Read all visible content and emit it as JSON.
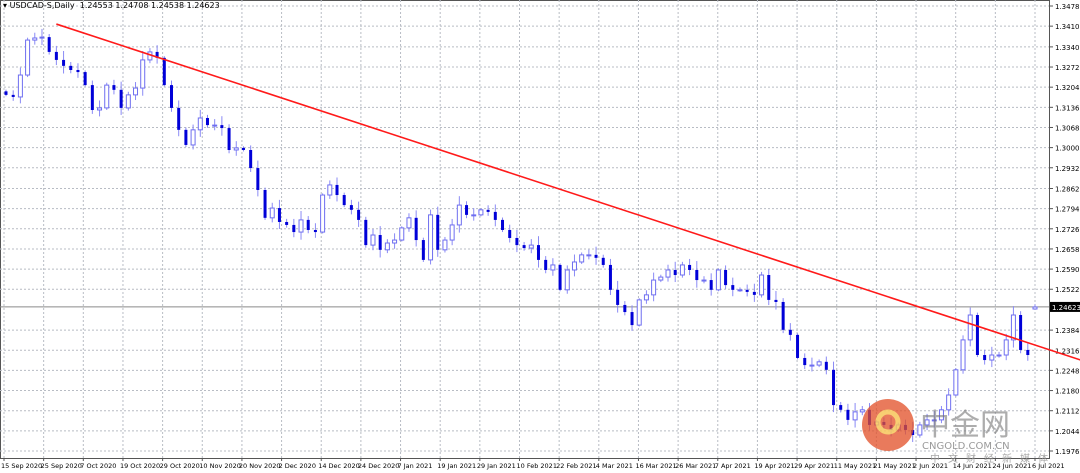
{
  "header": {
    "symbol": "USDCAD-S",
    "timeframe": "Daily",
    "ohlc_text": "1.24553 1.24708 1.24538 1.24623"
  },
  "watermark": {
    "logo_text": "中金网",
    "domain": "CNGOLD.COM.CN",
    "tagline": "中文财经新媒体"
  },
  "colors": {
    "bear_fill": "#0000d8",
    "bull_border": "#6e6ef0",
    "wick": "#8a8af5",
    "trendline": "#ff1a1a",
    "grid": "#b8bcc4",
    "price_label_bg": "#000000"
  },
  "chart_data": {
    "type": "candlestick",
    "title": "USDCAD-S,Daily",
    "current_price": 1.24623,
    "last_bar": {
      "open": 1.24553,
      "high": 1.24708,
      "low": 1.24538,
      "close": 1.24623
    },
    "ylim": [
      1.1976,
      1.3478
    ],
    "y_ticks": [
      "1.34780",
      "1.34100",
      "1.33400",
      "1.32720",
      "1.32040",
      "1.31360",
      "1.30680",
      "1.30000",
      "1.29320",
      "1.28620",
      "1.27940",
      "1.27260",
      "1.26580",
      "1.25900",
      "1.25220",
      "1.23840",
      "1.23160",
      "1.22480",
      "1.21800",
      "1.21120",
      "1.20440",
      "1.19760"
    ],
    "x_ticks": [
      "15 Sep 2020",
      "25 Sep 2020",
      "7 Oct 2020",
      "19 Oct 2020",
      "29 Oct 2020",
      "10 Nov 2020",
      "20 Nov 2020",
      "2 Dec 2020",
      "14 Dec 2020",
      "24 Dec 2020",
      "7 Jan 2021",
      "19 Jan 2021",
      "29 Jan 2021",
      "10 Feb 2021",
      "22 Feb 2021",
      "4 Mar 2021",
      "16 Mar 2021",
      "26 Mar 2021",
      "7 Apr 2021",
      "19 Apr 2021",
      "29 Apr 2021",
      "11 May 2021",
      "21 May 2021",
      "2 Jun 2021",
      "14 Jun 2021",
      "24 Jun 2021",
      "6 Jul 2021"
    ],
    "closes": [
      1.3178,
      1.3171,
      1.3245,
      1.3363,
      1.337,
      1.3373,
      1.3323,
      1.3296,
      1.3276,
      1.3262,
      1.3255,
      1.3211,
      1.3127,
      1.3134,
      1.3211,
      1.3195,
      1.3134,
      1.3178,
      1.3201,
      1.3296,
      1.3323,
      1.3303,
      1.3211,
      1.3134,
      1.306,
      1.3009,
      1.306,
      1.31,
      1.3076,
      1.3076,
      1.3066,
      1.2992,
      1.2999,
      1.2992,
      1.2931,
      1.2857,
      1.2763,
      1.2796,
      1.2749,
      1.2739,
      1.2715,
      1.2756,
      1.2722,
      1.2715,
      1.284,
      1.2874,
      1.284,
      1.2806,
      1.279,
      1.2756,
      1.2671,
      1.2705,
      1.2655,
      1.2678,
      1.2688,
      1.2729,
      1.2763,
      1.2688,
      1.2621,
      1.2773,
      1.2655,
      1.2688,
      1.2739,
      1.2806,
      1.2773,
      1.2773,
      1.279,
      1.2783,
      1.2756,
      1.2722,
      1.2695,
      1.2671,
      1.2661,
      1.2671,
      1.2621,
      1.2587,
      1.2604,
      1.252,
      1.2587,
      1.2614,
      1.2638,
      1.2638,
      1.2628,
      1.2604,
      1.252,
      1.2469,
      1.2445,
      1.2401,
      1.2486,
      1.2503,
      1.2553,
      1.2563,
      1.2587,
      1.257,
      1.2604,
      1.2587,
      1.2553,
      1.2553,
      1.252,
      1.2587,
      1.2536,
      1.252,
      1.252,
      1.2513,
      1.2503,
      1.257,
      1.2486,
      1.2479,
      1.2385,
      1.2368,
      1.229,
      1.2266,
      1.2266,
      1.2277,
      1.225,
      1.2131,
      1.2115,
      1.2081,
      1.2108,
      1.2115,
      1.2064,
      1.2074,
      1.2064,
      1.2047,
      1.2064,
      1.2047,
      1.203,
      1.2064,
      1.2081,
      1.2081,
      1.2115,
      1.2165,
      1.225,
      1.2351,
      1.2435,
      1.23,
      1.2283,
      1.23,
      1.23,
      1.2351,
      1.2435,
      1.2317,
      1.23,
      1.2462
    ],
    "trendline": {
      "start_bar": 7,
      "start_price": 1.3417,
      "end_bar": 151.5,
      "end_price": 1.2266
    }
  }
}
